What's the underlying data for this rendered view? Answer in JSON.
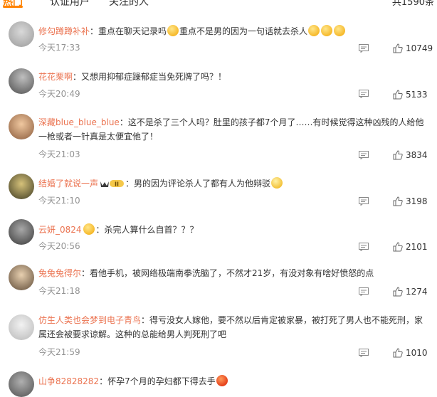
{
  "tabs": [
    {
      "label": "热门",
      "active": true
    },
    {
      "label": "认证用户",
      "active": false
    },
    {
      "label": "关注的人",
      "active": false
    }
  ],
  "total_label": "共1590条",
  "colors": {
    "accent": "#ff8200",
    "username": "#eb7350",
    "time": "#939393"
  },
  "comments": [
    {
      "user": "修勾蹲蹲补补",
      "text1": "：重点在聊天记录吗",
      "text2": "重点不是男的因为一句话就去杀人",
      "time": "今天17:33",
      "likes": "10749"
    },
    {
      "user": "花花栗啊",
      "text": "：又想用抑郁症躁郁症当免死牌了吗？！",
      "time": "今天20:49",
      "likes": "5133"
    },
    {
      "user": "深藏blue_blue_blue",
      "text": "：这不是杀了三个人吗？肚里的孩子都7个月了……有时候觉得这种凶残的人给他一枪或者一针真是太便宜他了！",
      "time": "今天21:03",
      "likes": "3834"
    },
    {
      "user": "结婚了就说一声",
      "badge": "II",
      "text": "：男的因为评论杀人了都有人为他辩驳",
      "time": "今天21:10",
      "likes": "3198"
    },
    {
      "user": "云妍_0824",
      "text": "：杀完人算什么自首？？？",
      "time": "今天20:56",
      "likes": "2101"
    },
    {
      "user": "兔兔兔得尔",
      "text": "：看他手机，被网络极端南拳洗脑了，不然才21岁，有没对象有啥好愤怒的点",
      "time": "今天21:18",
      "likes": "1274"
    },
    {
      "user": "仿生人类也会梦到电子青鸟",
      "text": "：得亏没女人嫁他，要不然以后肯定被家暴，被打死了男人也不能死刑，家属还会被要求谅解。这种的总能给男人判死刑了吧",
      "time": "今天21:59",
      "likes": "1010"
    },
    {
      "user": "山争82828282",
      "text": "：怀孕7个月的孕妇都下得去手",
      "time": "",
      "likes": ""
    }
  ]
}
